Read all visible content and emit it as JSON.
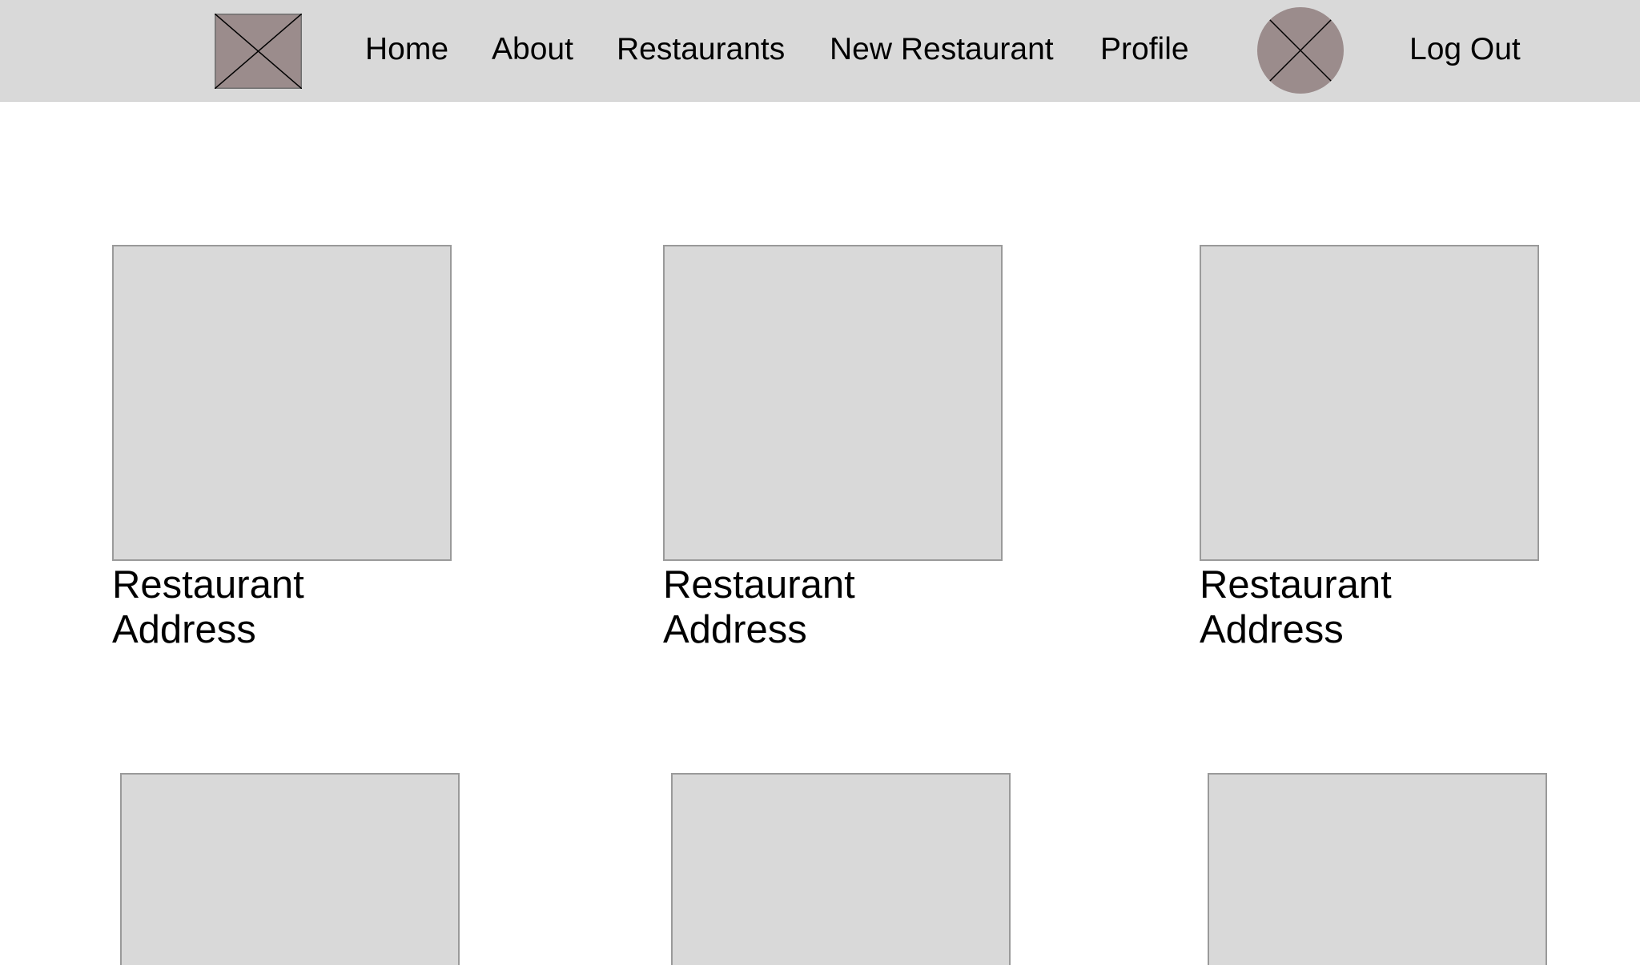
{
  "nav": {
    "logo_icon": "placeholder-image-icon",
    "links": [
      {
        "label": "Home"
      },
      {
        "label": "About"
      },
      {
        "label": "Restaurants"
      },
      {
        "label": "New Restaurant"
      },
      {
        "label": "Profile"
      }
    ],
    "avatar_icon": "user-avatar-placeholder-icon",
    "logout_label": "Log Out"
  },
  "restaurants": [
    {
      "name": "Restaurant",
      "address": "Address"
    },
    {
      "name": "Restaurant",
      "address": "Address"
    },
    {
      "name": "Restaurant",
      "address": "Address"
    }
  ],
  "colors": {
    "navbar_bg": "#d9d9d9",
    "placeholder_fill": "#9b8c8c",
    "card_fill": "#d9d9d9",
    "card_border": "#9a9a9a"
  }
}
